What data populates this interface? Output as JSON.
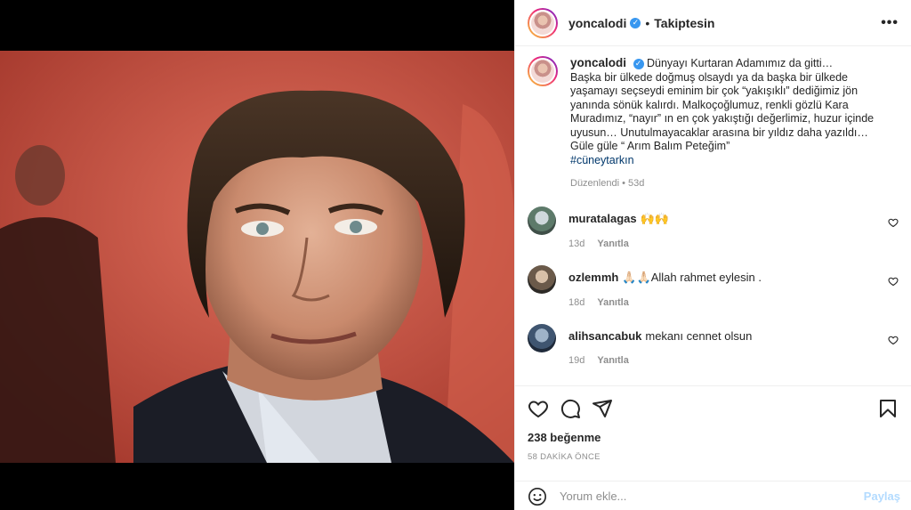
{
  "post": {
    "username": "yoncalodi",
    "follow_status": "Takiptesin",
    "more_label": "•••",
    "caption_lines": [
      "Dünyayı Kurtaran Adamımız da gitti…",
      "Başka bir ülkede doğmuş olsaydı ya da başka bir ülkede",
      "yaşamayı seçseydi eminim bir çok “yakışıklı” dediğimiz jön",
      "yanında sönük kalırdı. Malkoçoğlumuz, renkli gözlü Kara",
      "Muradımız, “nayır” ın en çok yakıştığı değerlimiz, huzur içinde",
      "uyusun… Unutulmayacaklar arasına bir yıldız daha yazıldı…",
      "Güle güle “ Arım Balım Peteğim”"
    ],
    "hashtag": "#cüneytarkın",
    "edited_label": "Düzenlendi",
    "edited_time": "53d"
  },
  "comments": [
    {
      "username": "muratalagas",
      "text": "🙌🙌",
      "time": "13d",
      "reply_label": "Yanıtla"
    },
    {
      "username": "ozlemmh",
      "text": "🙏🏻🙏🏻Allah rahmet eylesin .",
      "time": "18d",
      "reply_label": "Yanıtla"
    },
    {
      "username": "alihsancabuk",
      "text": "mekanı cennet olsun",
      "time": "19d",
      "reply_label": "Yanıtla"
    }
  ],
  "stats": {
    "likes": "238 beğenme",
    "posted_ago": "58 DAKİKA ÖNCE"
  },
  "composer": {
    "placeholder": "Yorum ekle...",
    "post_label": "Paylaş"
  },
  "icons": [
    "heart-icon",
    "comment-icon",
    "share-icon",
    "bookmark-icon",
    "emoji-icon",
    "verified-badge-icon"
  ],
  "colors": {
    "link": "#00376b",
    "verified": "#3897f0",
    "post_button": "#b3dbff",
    "muted": "#8e8e8e"
  }
}
